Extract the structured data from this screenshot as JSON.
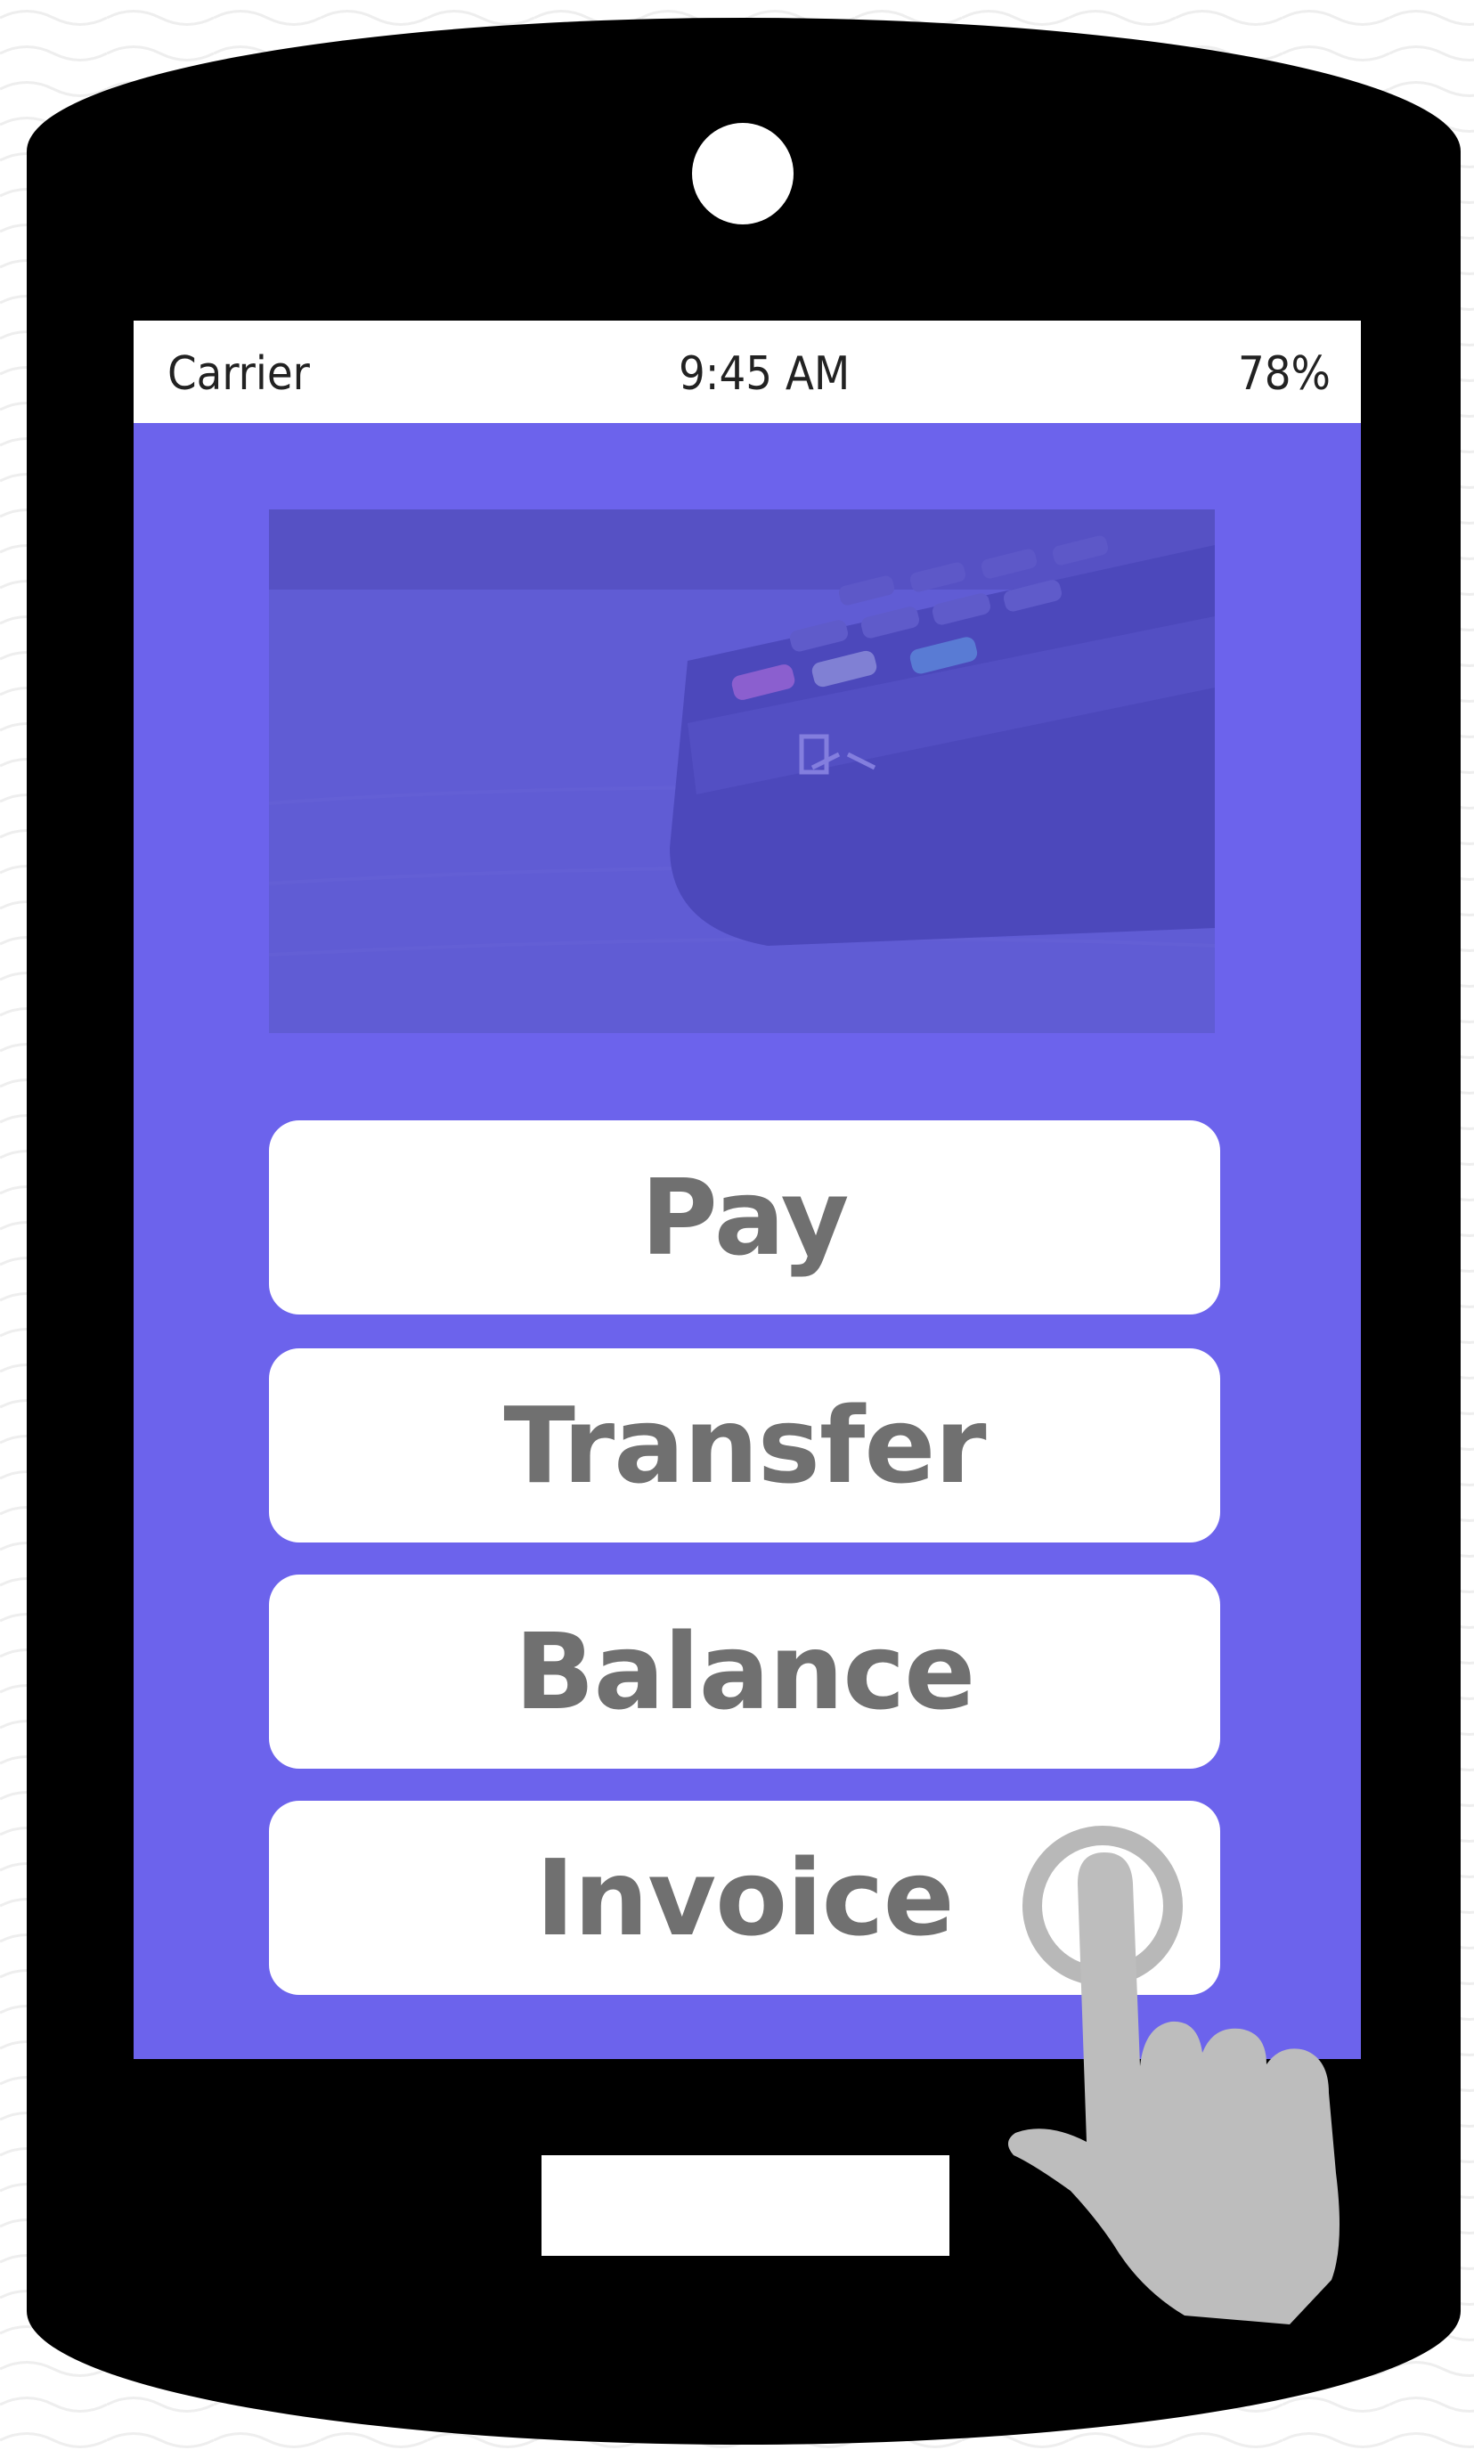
{
  "status_bar": {
    "carrier": "Carrier",
    "time": "9:45 AM",
    "battery": "78%"
  },
  "hero_image": {
    "subject": "card payment terminal keypad",
    "tint_color": "#6c63ec"
  },
  "menu": {
    "items": [
      {
        "label": "Pay"
      },
      {
        "label": "Transfer"
      },
      {
        "label": "Balance"
      },
      {
        "label": "Invoice"
      }
    ]
  },
  "colors": {
    "device": "#000000",
    "screen": "#6c63ec",
    "button": "#ffffff",
    "button_text": "#707070",
    "hand": "#bdbdbd"
  },
  "icons": {
    "touch": "hand-pointer-icon",
    "ripple": "touch-ripple-icon"
  }
}
